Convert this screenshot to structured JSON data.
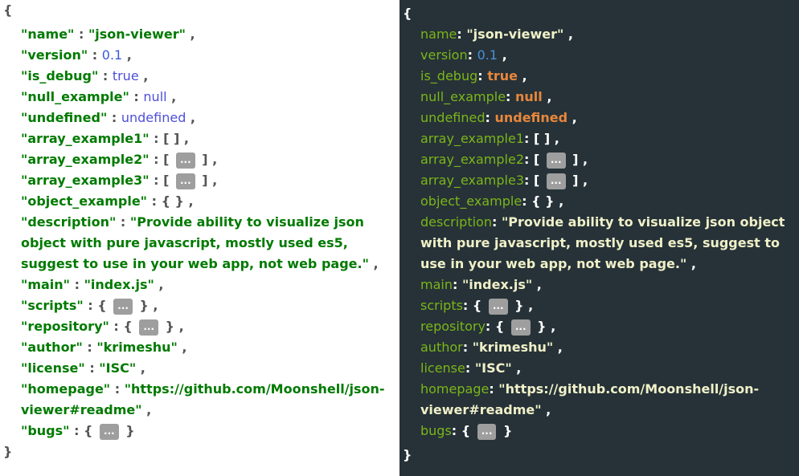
{
  "viewer": {
    "open_brace": "{",
    "close_brace": "}",
    "collapsed_label": "...",
    "rows": [
      {
        "key": "name",
        "value": "\"json-viewer\"",
        "type": "string"
      },
      {
        "key": "version",
        "value": "0.1",
        "type": "number"
      },
      {
        "key": "is_debug",
        "value": "true",
        "type": "boolean"
      },
      {
        "key": "null_example",
        "value": "null",
        "type": "boolean"
      },
      {
        "key": "undefined",
        "value": "undefined",
        "type": "boolean"
      },
      {
        "key": "array_example1",
        "value": "[ ]",
        "type": "empty"
      },
      {
        "key": "array_example2",
        "open": "[",
        "close": "]",
        "type": "collapsed"
      },
      {
        "key": "array_example3",
        "open": "[",
        "close": "]",
        "type": "collapsed"
      },
      {
        "key": "object_example",
        "value": "{ }",
        "type": "empty"
      },
      {
        "key": "description",
        "value": "\"Provide ability to visualize json object with pure javascript, mostly used es5, suggest to use in your web app, not web page.\"",
        "type": "string"
      },
      {
        "key": "main",
        "value": "\"index.js\"",
        "type": "string"
      },
      {
        "key": "scripts",
        "open": "{",
        "close": "}",
        "type": "collapsed"
      },
      {
        "key": "repository",
        "open": "{",
        "close": "}",
        "type": "collapsed"
      },
      {
        "key": "author",
        "value": "\"krimeshu\"",
        "type": "string"
      },
      {
        "key": "license",
        "value": "\"ISC\"",
        "type": "string"
      },
      {
        "key": "homepage",
        "value": "\"https://github.com/Moonshell/json-viewer#readme\"",
        "type": "string"
      },
      {
        "key": "bugs",
        "open": "{",
        "close": "}",
        "type": "collapsed"
      }
    ]
  },
  "themes": {
    "light": {
      "background": "#ffffff",
      "key": "#007a00",
      "string": "#007a00",
      "number": "#3b5bdb",
      "boolean": "#4f4fd9",
      "punct": "#555555"
    },
    "dark": {
      "background": "#263238",
      "key": "#7cb518",
      "string": "#f0f0c8",
      "number": "#4a90d9",
      "boolean": "#e8873c",
      "punct": "#ffffff"
    }
  }
}
